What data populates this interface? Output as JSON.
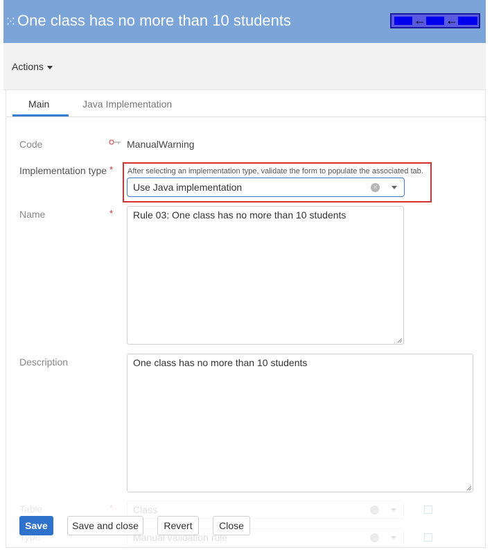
{
  "header": {
    "lead_glyph": "⁙",
    "title": "One class has no more than 10 students"
  },
  "toolbar": {
    "actions_label": "Actions"
  },
  "tabs": [
    {
      "label": "Main"
    },
    {
      "label": "Java Implementation"
    }
  ],
  "form": {
    "code": {
      "label": "Code",
      "value": "ManualWarning"
    },
    "implementation_type": {
      "label": "Implementation type",
      "required_mark": "*",
      "hint": "After selecting an implementation type, validate the form to populate the associated tab.",
      "value": "Use Java implementation"
    },
    "name": {
      "label": "Name",
      "required_mark": "*",
      "value": "Rule 03: One class has no more than 10 students"
    },
    "description": {
      "label": "Description",
      "value": "One class has no more than 10 students"
    },
    "table": {
      "label": "Table",
      "required_mark": "*",
      "value": "Class"
    },
    "type": {
      "label": "Type",
      "value": "Manual validation rule"
    }
  },
  "buttons": {
    "save": "Save",
    "save_and_close": "Save and close",
    "revert": "Revert",
    "close": "Close"
  },
  "colors": {
    "header_bg": "#7ba4d9",
    "accent": "#2e72cc",
    "highlight_border": "#d93030",
    "required": "#d32f2f"
  },
  "icons": {
    "code": "key-icon",
    "clear": "clear-icon",
    "dropdown": "chevron-down-icon",
    "external": "external-link-icon"
  }
}
